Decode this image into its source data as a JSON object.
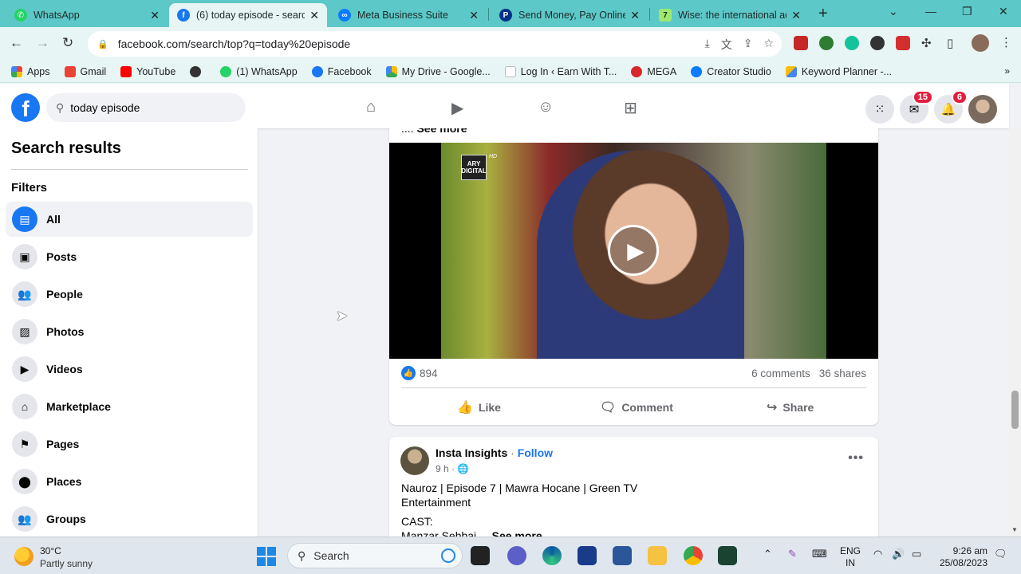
{
  "browser": {
    "tabs": [
      {
        "title": "WhatsApp",
        "color": "#25d366",
        "glyph": "✆"
      },
      {
        "title": "(6) today episode - search",
        "color": "#1877f2",
        "glyph": "f"
      },
      {
        "title": "Meta Business Suite",
        "color": "#0a7cff",
        "glyph": "∞"
      },
      {
        "title": "Send Money, Pay Online",
        "color": "#003087",
        "glyph": "P"
      },
      {
        "title": "Wise: the international ac",
        "color": "#9fe870",
        "glyph": "7"
      }
    ],
    "url": "facebook.com/search/top?q=today%20episode",
    "bookmarks": [
      {
        "label": "Apps",
        "color": "#e94235"
      },
      {
        "label": "Gmail",
        "color": "#ea4335"
      },
      {
        "label": "YouTube",
        "color": "#ff0000"
      },
      {
        "label": "",
        "color": "#333333"
      },
      {
        "label": "(1) WhatsApp",
        "color": "#25d366"
      },
      {
        "label": "Facebook",
        "color": "#1877f2"
      },
      {
        "label": "My Drive - Google...",
        "color": "#fbbc04"
      },
      {
        "label": "Log In ‹ Earn With T...",
        "color": "#dddddd"
      },
      {
        "label": "MEGA",
        "color": "#d9272e"
      },
      {
        "label": "Creator Studio",
        "color": "#0a7cff"
      },
      {
        "label": "Keyword Planner -...",
        "color": "#4285f4"
      }
    ]
  },
  "facebook": {
    "search_value": "today episode",
    "messenger_badge": "15",
    "notifications_badge": "6",
    "sidebar": {
      "title": "Search results",
      "filters_label": "Filters",
      "items": [
        {
          "label": "All",
          "icon": "▤"
        },
        {
          "label": "Posts",
          "icon": "▣"
        },
        {
          "label": "People",
          "icon": "👥"
        },
        {
          "label": "Photos",
          "icon": "▨"
        },
        {
          "label": "Videos",
          "icon": "▶"
        },
        {
          "label": "Marketplace",
          "icon": "⌂"
        },
        {
          "label": "Pages",
          "icon": "⚑"
        },
        {
          "label": "Places",
          "icon": "⬤"
        },
        {
          "label": "Groups",
          "icon": "👥"
        }
      ]
    },
    "post1": {
      "see_more_prefix": "....",
      "see_more": "See more",
      "channel_logo_top": "ARY",
      "channel_logo_bottom": "DIGITAL",
      "hd_label": "HD",
      "reactions_count": "894",
      "comments": "6 comments",
      "shares": "36 shares",
      "like_label": "Like",
      "comment_label": "Comment",
      "share_label": "Share"
    },
    "post2": {
      "author": "Insta Insights",
      "follow": "Follow",
      "time": "9 h",
      "text": "Nauroz | Episode 7 | Mawra Hocane | Green TV Entertainment",
      "cast_label": "CAST:",
      "cut_text": "Manzar Sehbai ...",
      "see_more": "See more"
    }
  },
  "taskbar": {
    "temperature": "30°C",
    "weather": "Partly sunny",
    "search_label": "Search",
    "lang_top": "ENG",
    "lang_bottom": "IN",
    "time": "9:26 am",
    "date": "25/08/2023"
  }
}
